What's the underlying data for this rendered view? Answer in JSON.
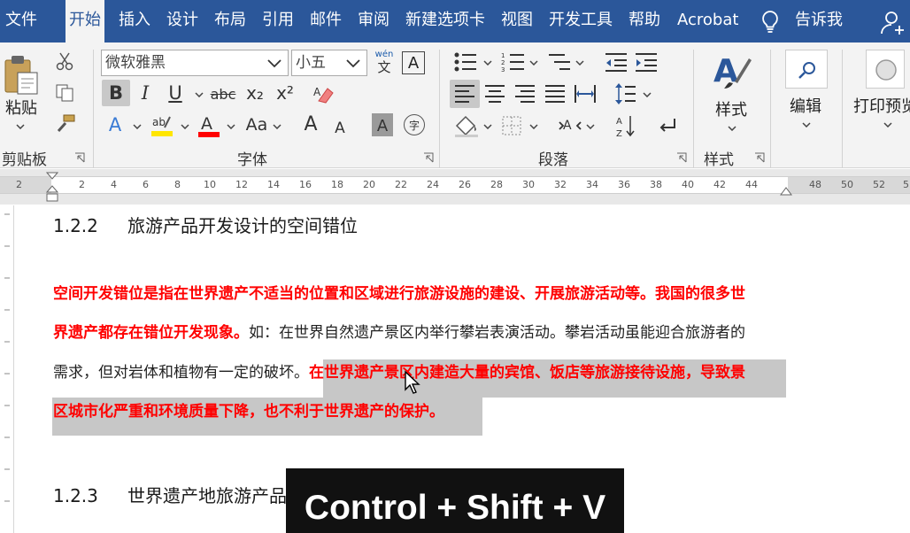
{
  "tabs": {
    "file": "文件",
    "home": "开始",
    "insert": "插入",
    "design": "设计",
    "layout": "布局",
    "references": "引用",
    "mailings": "邮件",
    "review": "审阅",
    "new_tab": "新建选项卡",
    "view": "视图",
    "developer": "开发工具",
    "help": "帮助",
    "acrobat": "Acrobat",
    "tell_me": "告诉我"
  },
  "ribbon": {
    "clipboard": {
      "paste_label": "粘贴",
      "group_label": "剪贴板"
    },
    "font": {
      "font_name": "微软雅黑",
      "font_size": "小五",
      "phonetic_label": "wén",
      "phonetic_char": "文",
      "charborder_char": "A",
      "bold": "B",
      "italic": "I",
      "underline": "U",
      "strike": "abc",
      "subscript": "x₂",
      "superscript": "x²",
      "change_case": "Aa",
      "grow": "A",
      "shrink": "A",
      "shading_char": "A",
      "enclose_char": "字",
      "group_label": "字体"
    },
    "paragraph": {
      "group_label": "段落"
    },
    "styles": {
      "styles_label": "样式",
      "group_label": "样式"
    },
    "editing": {
      "label": "编辑"
    },
    "print": {
      "label": "打印预览"
    }
  },
  "ruler": {
    "left_label": "2",
    "ticks": [
      "2",
      "4",
      "6",
      "8",
      "10",
      "12",
      "14",
      "16",
      "18",
      "20",
      "22",
      "24",
      "26",
      "28",
      "30",
      "32",
      "34",
      "36",
      "38",
      "40",
      "42",
      "44",
      "48",
      "50",
      "52",
      "5"
    ]
  },
  "document": {
    "heading1_num": "1.2.2",
    "heading1_text": "旅游产品开发设计的空间错位",
    "p1_line1": "空间开发错位是指在世界遗产不适当的位置和区域进行旅游设施的建设、开展旅游活动等。我国的很多世",
    "p1_line2_red": "界遗产都存在错位开发现象。",
    "p1_line2_normal": "如：在世界自然遗产景区内举行攀岩表演活动。攀岩活动虽能迎合旅游者的",
    "p1_line3_normal": "需求，但对岩体和植物有一定的破坏。",
    "p1_line3_sel": "在世界遗产景区内建造大量的宾馆、饭店等旅游接待设施，导致景",
    "p1_line4_sel": "区城市化严重和环境质量下降，也不利于世界遗产的保护。",
    "heading2_num": "1.2.3",
    "heading2_text": "世界遗产地旅游产品"
  },
  "overlay": {
    "shortcut": "Control + Shift + V"
  },
  "colors": {
    "tabbar": "#2b579a",
    "ribbon": "#f3f3f3",
    "red_text": "#ff0000",
    "selection": "#c7c7c7",
    "overlay": "#111111"
  }
}
